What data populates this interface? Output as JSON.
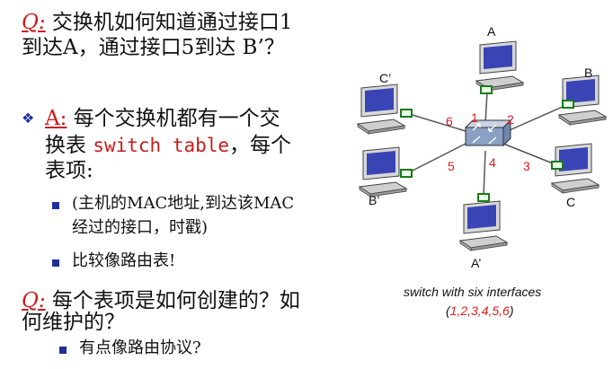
{
  "question1": {
    "mark": "Q:",
    "line1": " 交换机如何知道通过接口1",
    "line2": "到达A，通过接口5到达 B’？"
  },
  "answer": {
    "mark": "A:",
    "line1_text": "  每个交换机都有一个交",
    "line2_pre": "换表 ",
    "line2_red": "switch table",
    "line2_post": "，每个",
    "line3": "表项:",
    "bullets": [
      "(主机的MAC地址,到达该MAC",
      "经过的接口，时戳)",
      "比较像路由表!"
    ]
  },
  "question2": {
    "mark": "Q:",
    "line1": " 每个表项是如何创建的？如",
    "line2": "何维护的？",
    "bullet": "有点像路由协议?"
  },
  "diagram": {
    "hosts": [
      "A",
      "B",
      "C",
      "A’",
      "B’",
      "C’"
    ],
    "ports": [
      "1",
      "2",
      "3",
      "4",
      "5",
      "6"
    ],
    "caption_line1": "switch with six interfaces",
    "caption_open": "(",
    "caption_ports": "1,2,3,4,5,6",
    "caption_close": ")"
  },
  "colors": {
    "accent_red": "#cc1b1b",
    "bullet_blue": "#1f2f9a",
    "monitor_blue": "#3a45b5"
  }
}
